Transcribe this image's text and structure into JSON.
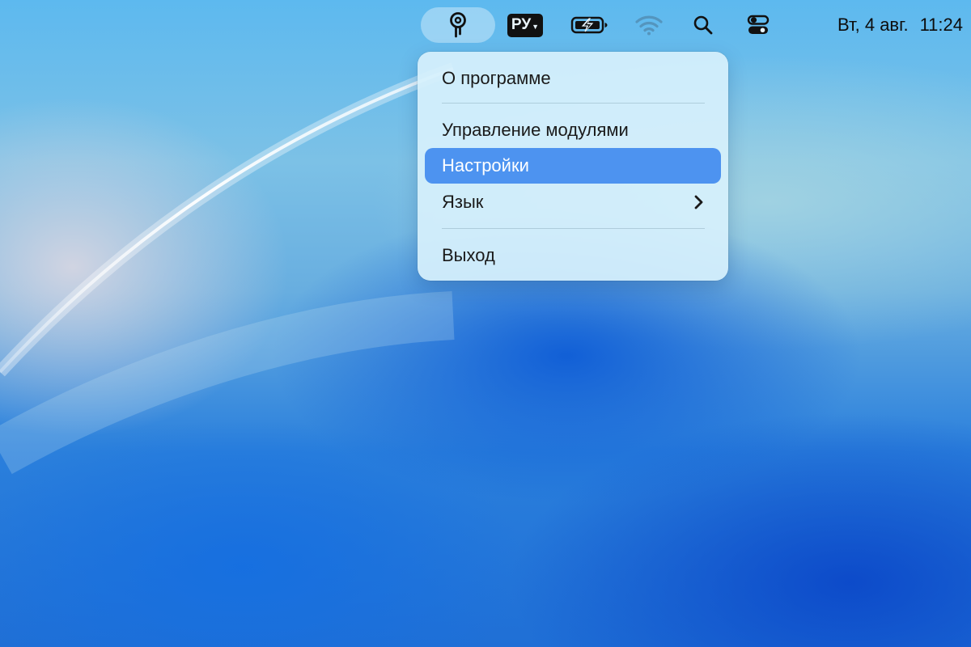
{
  "menubar": {
    "app_icon": "pin-icon",
    "input_source": {
      "label": "РУ",
      "icon": "chevron-down-icon"
    },
    "battery_icon": "battery-charging-icon",
    "wifi_icon": "wifi-icon",
    "search_icon": "search-icon",
    "control_center_icon": "control-center-icon",
    "clock": {
      "date": "Вт, 4 авг.",
      "time": "11:24"
    }
  },
  "menu": {
    "items": [
      {
        "label": "О программе"
      },
      {
        "label": "Управление модулями"
      },
      {
        "label": "Настройки",
        "selected": true
      },
      {
        "label": "Язык",
        "submenu_icon": "chevron-right-icon"
      },
      {
        "label": "Выход"
      }
    ]
  },
  "colors": {
    "selection": "#4d93f0",
    "menu_background": "#d6f0fc",
    "app_icon_highlight": "#c8e8fa"
  }
}
